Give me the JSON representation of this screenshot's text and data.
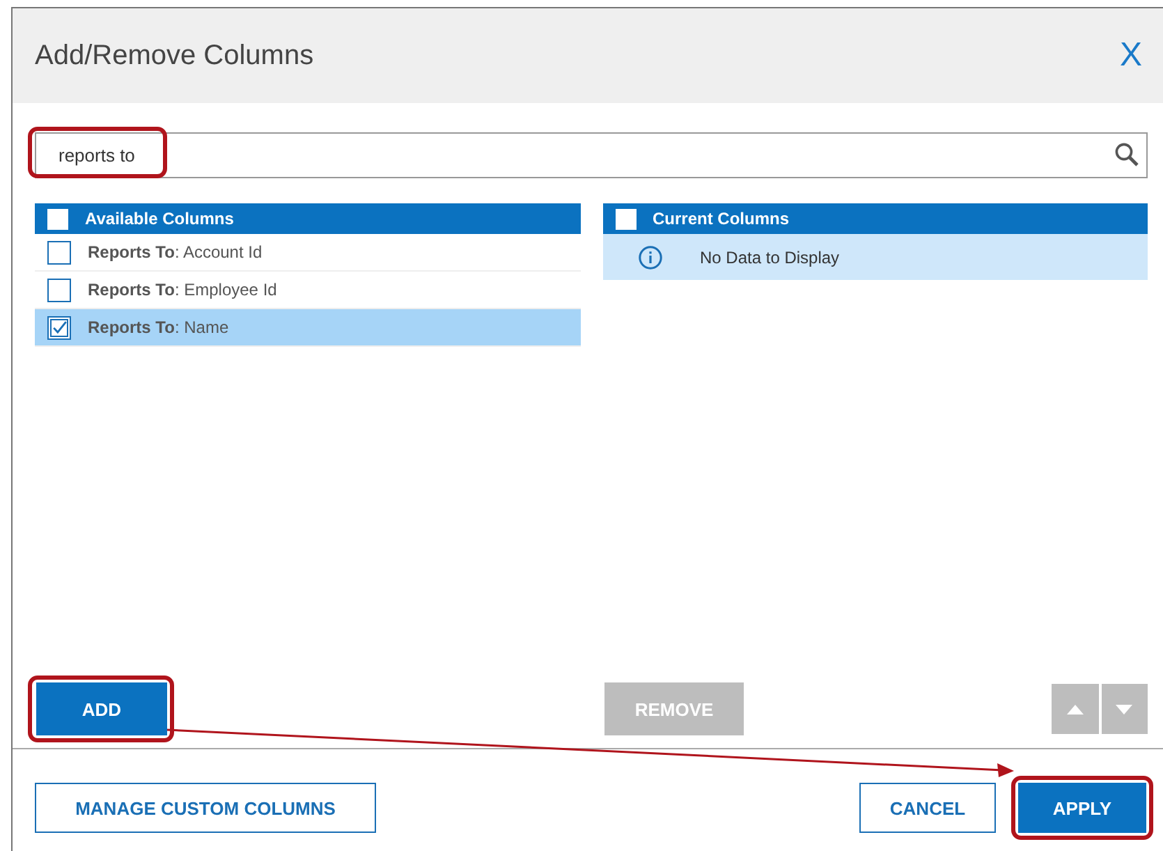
{
  "dialog": {
    "title": "Add/Remove Columns",
    "close": "X"
  },
  "search": {
    "value": "reports to",
    "highlighted": true
  },
  "available": {
    "title": "Available Columns",
    "checked": false,
    "items": [
      {
        "label": "**Reports To**: Account Id",
        "checked": false,
        "selected": false
      },
      {
        "label": "**Reports To**: Employee Id",
        "checked": false,
        "selected": false
      },
      {
        "label": "**Reports To**: Name",
        "checked": true,
        "selected": true
      }
    ]
  },
  "current": {
    "title": "Current Columns",
    "checked": false,
    "empty_message": "No Data to Display"
  },
  "actions": [
    {
      "kind": "add",
      "label": "ADD",
      "disabled": false,
      "highlighted": true
    },
    {
      "kind": "remove",
      "label": "REMOVE",
      "disabled": true,
      "highlighted": false
    },
    {
      "kind": "up",
      "disabled": true
    },
    {
      "kind": "down",
      "disabled": true
    }
  ],
  "footer": [
    {
      "kind": "secondary",
      "label": "MANAGE CUSTOM COLUMNS",
      "highlighted": false
    },
    {
      "kind": "secondary",
      "label": "CANCEL",
      "highlighted": false
    },
    {
      "kind": "primary",
      "label": "APPLY",
      "highlighted": true
    }
  ],
  "callout_arrow": true
}
